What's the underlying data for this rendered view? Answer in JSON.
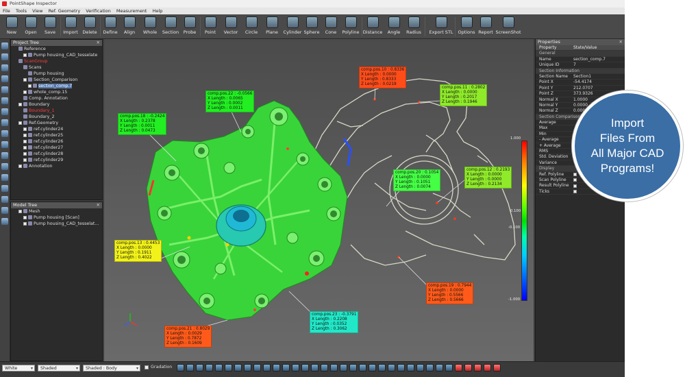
{
  "window": {
    "title": "PointShape Inspector"
  },
  "menu": [
    "File",
    "Tools",
    "View",
    "Ref. Geometry",
    "Verification",
    "Measurement",
    "Help"
  ],
  "toolbar": [
    "New",
    "Open",
    "Save",
    "Import",
    "Delete",
    "Define",
    "Align",
    "Whole",
    "Section",
    "Probe",
    "Point",
    "Vector",
    "Circle",
    "Plane",
    "Cylinder",
    "Sphere",
    "Cone",
    "Polyline",
    "Distance",
    "Angle",
    "Radius",
    "Export STL",
    "Options",
    "Report",
    "ScreenShot"
  ],
  "project_tree": {
    "title": "Project Tree",
    "items": [
      {
        "label": "Reference",
        "indent": 1,
        "red": false,
        "cb": false
      },
      {
        "label": "Pump housing_CAD_tesselate",
        "indent": 2,
        "red": false,
        "cb": true
      },
      {
        "label": "ScanGroup",
        "indent": 1,
        "red": true,
        "cb": false
      },
      {
        "label": "Scans",
        "indent": 2,
        "red": false,
        "cb": false
      },
      {
        "label": "Pump housing",
        "indent": 3,
        "red": false,
        "cb": false
      },
      {
        "label": "Section_Comparison",
        "indent": 2,
        "red": false,
        "cb": true
      },
      {
        "label": "section_comp.7",
        "indent": 3,
        "red": false,
        "cb": true,
        "sel": true
      },
      {
        "label": "whole_comp.15",
        "indent": 2,
        "red": false,
        "cb": true
      },
      {
        "label": "Comp. Annotation",
        "indent": 2,
        "red": false,
        "cb": false
      },
      {
        "label": "Boundary",
        "indent": 1,
        "red": false,
        "cb": true
      },
      {
        "label": "Boundary_1",
        "indent": 2,
        "red": true,
        "cb": false
      },
      {
        "label": "Boundary_2",
        "indent": 2,
        "red": false,
        "cb": false
      },
      {
        "label": "Ref.Geometry",
        "indent": 1,
        "red": false,
        "cb": true
      },
      {
        "label": "ref.cylinder24",
        "indent": 2,
        "red": false,
        "cb": true
      },
      {
        "label": "ref.cylinder25",
        "indent": 2,
        "red": false,
        "cb": true
      },
      {
        "label": "ref.cylinder26",
        "indent": 2,
        "red": false,
        "cb": true
      },
      {
        "label": "ref.cylinder27",
        "indent": 2,
        "red": false,
        "cb": true
      },
      {
        "label": "ref.cylinder28",
        "indent": 2,
        "red": false,
        "cb": true
      },
      {
        "label": "ref.cylinder29",
        "indent": 2,
        "red": false,
        "cb": true
      },
      {
        "label": "Annotation",
        "indent": 1,
        "red": false,
        "cb": true
      }
    ]
  },
  "model_tree": {
    "title": "Model Tree",
    "items": [
      {
        "label": "Mesh",
        "indent": 1
      },
      {
        "label": "Pump housing [Scan]",
        "indent": 2
      },
      {
        "label": "Pump housing_CAD_tesselat...",
        "indent": 2
      }
    ]
  },
  "properties": {
    "title": "Properties",
    "header": [
      "Property",
      "State/Value"
    ],
    "rows": [
      {
        "k": "General",
        "v": "",
        "type": "grp"
      },
      {
        "k": "Name",
        "v": "section_comp.7"
      },
      {
        "k": "Unique ID",
        "v": "7"
      },
      {
        "k": "Section Information",
        "v": "",
        "type": "grp"
      },
      {
        "k": "Section Name",
        "v": "Section1"
      },
      {
        "k": "Point X",
        "v": "-54.4174"
      },
      {
        "k": "Point Y",
        "v": "212.0707"
      },
      {
        "k": "Point Z",
        "v": "373.9326"
      },
      {
        "k": "Normal X",
        "v": "1.0000"
      },
      {
        "k": "Normal Y",
        "v": "0.0000"
      },
      {
        "k": "Normal Z",
        "v": "0.0000"
      },
      {
        "k": "Section Comparison",
        "v": "",
        "type": "grp"
      },
      {
        "k": "Average",
        "v": ""
      },
      {
        "k": "Max",
        "v": ""
      },
      {
        "k": "Min",
        "v": ""
      },
      {
        "k": "- Average",
        "v": ""
      },
      {
        "k": "+ Average",
        "v": ""
      },
      {
        "k": "RMS",
        "v": ""
      },
      {
        "k": "Std. Deviation",
        "v": ""
      },
      {
        "k": "Variance",
        "v": ""
      },
      {
        "k": "Display",
        "v": "",
        "type": "grp"
      },
      {
        "k": "Ref. Polyline",
        "v": "",
        "type": "chk"
      },
      {
        "k": "Scan Polyline",
        "v": "",
        "type": "chk"
      },
      {
        "k": "Result Polyline",
        "v": "",
        "type": "chk"
      },
      {
        "k": "Ticks",
        "v": "",
        "type": "chk"
      }
    ]
  },
  "annotations": [
    {
      "title": "comp.pos.10 : 0.8336",
      "lines": [
        "X Length : 0.0000",
        "Y Length : 0.8333",
        "Z Length : 0.0219"
      ],
      "color": "#ff4d1a"
    },
    {
      "title": "comp.pos.11 : 0.2802",
      "lines": [
        "X Length : 0.0000",
        "Y Length : 0.2017",
        "Z Length : 0.1946"
      ],
      "color": "#8fea2a"
    },
    {
      "title": "comp.pos.22 : -0.0566",
      "lines": [
        "X Length : 0.0065",
        "Y Length : 0.0002",
        "Z Length : 0.0011"
      ],
      "color": "#22ee22"
    },
    {
      "title": "comp.pos.18 : -0.2424",
      "lines": [
        "X Length : 0.2378",
        "Y Length : 0.0011",
        "Z Length : 0.0473"
      ],
      "color": "#22ee22"
    },
    {
      "title": "comp.pos.20 : 0.1054",
      "lines": [
        "X Length : 0.0000",
        "Y Length : 0.1051",
        "Z Length : 0.0074"
      ],
      "color": "#44ff44"
    },
    {
      "title": "comp.pos.12 : 0.2193",
      "lines": [
        "X Length : 0.0000",
        "Y Length : 0.0000",
        "Z Length : 0.2134"
      ],
      "color": "#8fea2a"
    },
    {
      "title": "comp.pos.13 : 0.4453",
      "lines": [
        "X Length : 0.0000",
        "Y Length : 0.1911",
        "Z Length : 0.4022"
      ],
      "color": "#f2f21a"
    },
    {
      "title": "comp.pos.19 : 0.7944",
      "lines": [
        "X Length : 0.0000",
        "Y Length : 0.5566",
        "Z Length : 0.5666"
      ],
      "color": "#ff5a1a"
    },
    {
      "title": "comp.pos.23 : -0.3791",
      "lines": [
        "X Length : 0.2208",
        "Y Length : 0.0352",
        "Z Length : 0.3062"
      ],
      "color": "#22e8c8"
    },
    {
      "title": "comp.pos.21 : 0.8029",
      "lines": [
        "X Length : 0.0029",
        "Y Length : 0.7872",
        "Z Length : 0.1609"
      ],
      "color": "#ff5a1a"
    }
  ],
  "colorbar": {
    "max": "1.000",
    "mid_hi": "0.100",
    "mid_lo": "-0.100",
    "min": "-1.000",
    "colors": [
      "#ff0000",
      "#ffff00",
      "#00e000",
      "#00ccff",
      "#0000ff"
    ]
  },
  "statusbar": {
    "bg_color": "White",
    "render_mode": "Shaded",
    "shade_target": "Shaded : Body",
    "gradation": "Gradation"
  },
  "badge": {
    "lines": [
      "Import",
      "Files From",
      "All Major CAD",
      "Programs!"
    ],
    "color": "#3a6ea5"
  }
}
